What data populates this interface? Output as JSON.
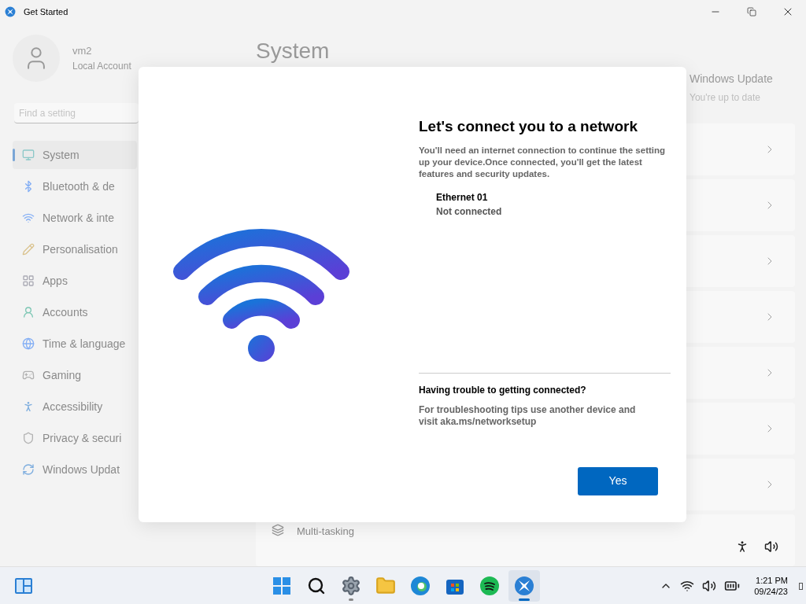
{
  "window": {
    "title": "Get Started"
  },
  "account": {
    "name": "vm2",
    "type": "Local Account"
  },
  "search": {
    "placeholder": "Find a setting"
  },
  "sidebar": {
    "items": [
      {
        "label": "System",
        "selected": true
      },
      {
        "label": "Bluetooth & de",
        "selected": false
      },
      {
        "label": "Network & inte",
        "selected": false
      },
      {
        "label": "Personalisation",
        "selected": false
      },
      {
        "label": "Apps",
        "selected": false
      },
      {
        "label": "Accounts",
        "selected": false
      },
      {
        "label": "Time & language",
        "selected": false
      },
      {
        "label": "Gaming",
        "selected": false
      },
      {
        "label": "Accessibility",
        "selected": false
      },
      {
        "label": "Privacy & securi",
        "selected": false
      },
      {
        "label": "Windows Updat",
        "selected": false
      }
    ]
  },
  "page": {
    "title": "System",
    "update": {
      "title": "Windows Update",
      "status": "You're up to date"
    },
    "next_item": "Multi-tasking"
  },
  "dialog": {
    "title": "Let's connect you to a network",
    "body": "You'll need an internet connection to continue the setting up your device.Once connected, you'll get the latest features and security updates.",
    "connection": {
      "name": "Ethernet 01",
      "status": "Not connected"
    },
    "help_title": "Having trouble to getting connected?",
    "help_body": "For troubleshooting tips use another device and visit aka.ms/networksetup",
    "button": "Yes"
  },
  "taskbar": {
    "apps": [
      {
        "kind": "start",
        "running": false,
        "selected": false
      },
      {
        "kind": "search",
        "running": false,
        "selected": false
      },
      {
        "kind": "settings",
        "running": true,
        "selected": false
      },
      {
        "kind": "files",
        "running": false,
        "selected": false
      },
      {
        "kind": "browser",
        "running": false,
        "selected": false
      },
      {
        "kind": "store",
        "running": false,
        "selected": false
      },
      {
        "kind": "music",
        "running": false,
        "selected": false
      },
      {
        "kind": "getstarted",
        "running": true,
        "selected": true
      }
    ],
    "clock": {
      "time": "1:21 PM",
      "date": "09/24/23"
    }
  }
}
